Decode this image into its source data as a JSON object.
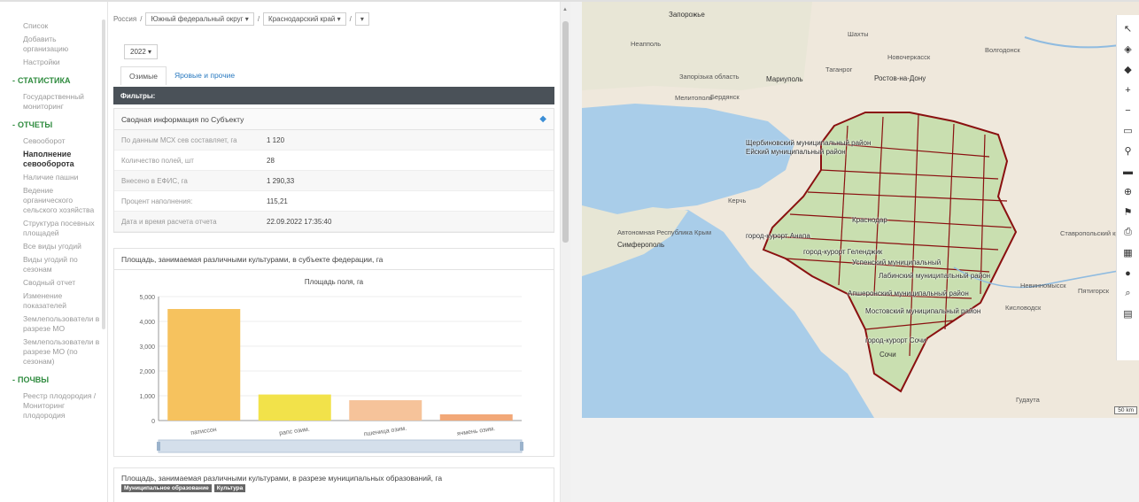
{
  "sidebar": {
    "items_top": [
      "Список",
      "Добавить организацию",
      "Настройки"
    ],
    "section_stats": "СТАТИСТИКА",
    "stats_items": [
      "Государственный мониторинг"
    ],
    "section_reports": "ОТЧЕТЫ",
    "reports_items": [
      "Севооборот",
      "Наполнение севооборота",
      "Наличие пашни",
      "Ведение органического сельского хозяйства",
      "Структура посевных площадей",
      "Все виды угодий",
      "Виды угодий по сезонам",
      "Сводный отчет",
      "Изменение показателей",
      "Землепользователи в разрезе МО",
      "Землепользователи в разрезе МО (по сезонам)"
    ],
    "section_soils": "ПОЧВЫ",
    "soils_items": [
      "Реестр плодородия / Мониторинг плодородия"
    ]
  },
  "breadcrumb": {
    "root": "Россия",
    "district": "Южный федеральный округ",
    "region": "Краснодарский край",
    "empty": ""
  },
  "year": "2022",
  "tabs": [
    "Озимые",
    "Яровые и прочие"
  ],
  "filters_label": "Фильтры:",
  "summary": {
    "title": "Сводная информация по Субъекту",
    "rows": [
      {
        "k": "По данным МСХ сев составляет, га",
        "v": "1 120"
      },
      {
        "k": "Количество полей, шт",
        "v": "28"
      },
      {
        "k": "Внесено в ЕФИС, га",
        "v": "1 290,33"
      },
      {
        "k": "Процент наполнения:",
        "v": "115,21"
      },
      {
        "k": "Дата и время расчета отчета",
        "v": "22.09.2022 17:35:40"
      }
    ]
  },
  "chart_panel_title": "Площадь, занимаемая различными культурами, в субъекте федерации, га",
  "chart_data": {
    "type": "bar",
    "title": "Площадь поля, га",
    "categories": [
      "патиссон",
      "рапс озим.",
      "пшеница озим.",
      "ячмень озим."
    ],
    "values": [
      4500,
      1050,
      820,
      250
    ],
    "ylim": [
      0,
      5000
    ],
    "yticks": [
      "0",
      "1,000",
      "2,000",
      "3,000",
      "4,000",
      "5,000"
    ],
    "colors": [
      "#f6c25e",
      "#f2e24a",
      "#f6c39a",
      "#f2a878"
    ]
  },
  "panel2": {
    "title": "Площадь, занимаемая различными культурами, в разрезе муниципальных образований, га",
    "tags": [
      "Муниципальное образование",
      "Культура"
    ]
  },
  "map": {
    "labels": [
      {
        "t": "Запорожье",
        "cls": "city"
      },
      {
        "t": "Мариуполь",
        "cls": "city"
      },
      {
        "t": "Ростов-на-Дону",
        "cls": "city"
      },
      {
        "t": "Симферополь",
        "cls": "city"
      },
      {
        "t": "Сочи",
        "cls": "city"
      },
      {
        "t": "Бердянск",
        "cls": ""
      },
      {
        "t": "Мелитополь",
        "cls": ""
      },
      {
        "t": "Шахты",
        "cls": ""
      },
      {
        "t": "Новочеркасск",
        "cls": ""
      },
      {
        "t": "Таганрог",
        "cls": ""
      },
      {
        "t": "Волгодонск",
        "cls": ""
      },
      {
        "t": "Ейский муниципальный район",
        "cls": "dist"
      },
      {
        "t": "Щербиновский муниципальный район",
        "cls": "dist"
      },
      {
        "t": "город-курорт Анапа",
        "cls": "dist"
      },
      {
        "t": "Краснодар",
        "cls": "dist"
      },
      {
        "t": "город-курорт Геленджик",
        "cls": "dist"
      },
      {
        "t": "город-курорт Сочи",
        "cls": "dist"
      },
      {
        "t": "Успенский муниципальный",
        "cls": "dist"
      },
      {
        "t": "Лабинский муниципальный район",
        "cls": "dist"
      },
      {
        "t": "Апшеронский муниципальный район",
        "cls": "dist"
      },
      {
        "t": "Мостовский муниципальный район",
        "cls": "dist"
      },
      {
        "t": "Пятигорск",
        "cls": ""
      },
      {
        "t": "Кисловодск",
        "cls": ""
      },
      {
        "t": "Ставропольский край",
        "cls": ""
      },
      {
        "t": "Автономная Республика Крым",
        "cls": ""
      },
      {
        "t": "Керчь",
        "cls": ""
      },
      {
        "t": "Невинномысск",
        "cls": ""
      },
      {
        "t": "Запорізька область",
        "cls": ""
      },
      {
        "t": "Неапполь",
        "cls": ""
      },
      {
        "t": "Гудаута",
        "cls": ""
      }
    ],
    "scale": "50 km"
  },
  "toolbar_icons": [
    "select-arrow-icon",
    "layers-icon",
    "layers-down-icon",
    "zoom-in-icon",
    "zoom-out-icon",
    "ruler-icon",
    "pin-icon",
    "measure-icon",
    "zoom-area-icon",
    "flag-icon",
    "print-icon",
    "grid-icon",
    "location-icon",
    "search-icon",
    "legend-icon"
  ]
}
